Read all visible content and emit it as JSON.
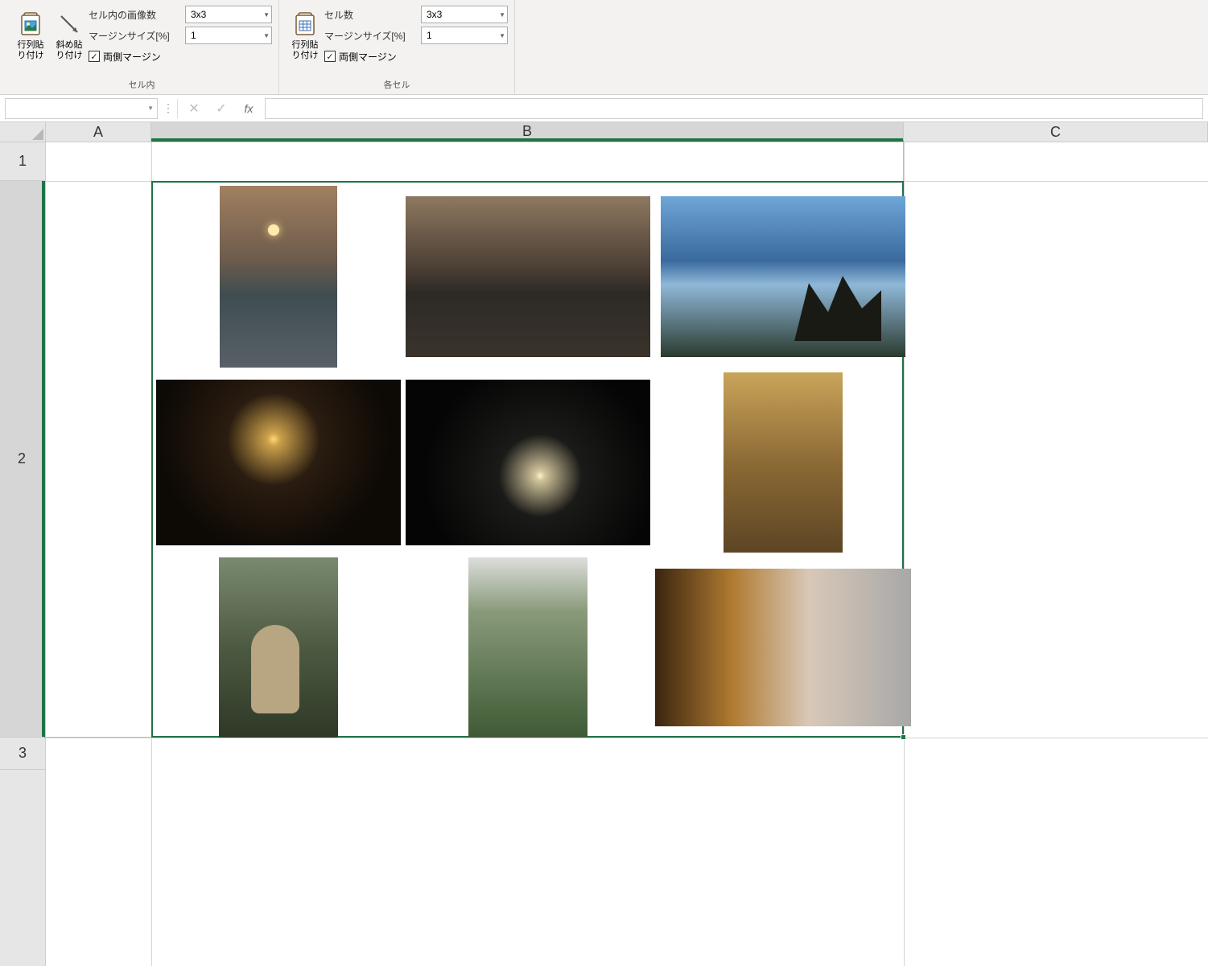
{
  "ribbon": {
    "group1": {
      "label": "セル内",
      "btn1": "行列貼\nり付け",
      "btn2": "斜め貼\nり付け",
      "row1_label": "セル内の画像数",
      "row1_value": "3x3",
      "row2_label": "マージンサイズ[%]",
      "row2_value": "1",
      "chk_label": "両側マージン",
      "chk_checked": "✓"
    },
    "group2": {
      "label": "各セル",
      "btn1": "行列貼\nり付け",
      "row1_label": "セル数",
      "row1_value": "3x3",
      "row2_label": "マージンサイズ[%]",
      "row2_value": "1",
      "chk_label": "両側マージン",
      "chk_checked": "✓"
    }
  },
  "formula_bar": {
    "name_box": "",
    "fx": "fx",
    "formula": ""
  },
  "grid": {
    "columns": {
      "A": "A",
      "B": "B",
      "C": "C"
    },
    "rows": {
      "r1": "1",
      "r2": "2",
      "r3": "3"
    },
    "selection": "B2"
  },
  "images": [
    {
      "name": "sunset-portrait-beach"
    },
    {
      "name": "sunset-wide-beach"
    },
    {
      "name": "ocean-rocks-coast"
    },
    {
      "name": "moon-orange-night"
    },
    {
      "name": "moon-clouds-night"
    },
    {
      "name": "indoor-warm-scene"
    },
    {
      "name": "cherub-statue-park"
    },
    {
      "name": "forest-path-person"
    },
    {
      "name": "evening-street-shop"
    }
  ]
}
